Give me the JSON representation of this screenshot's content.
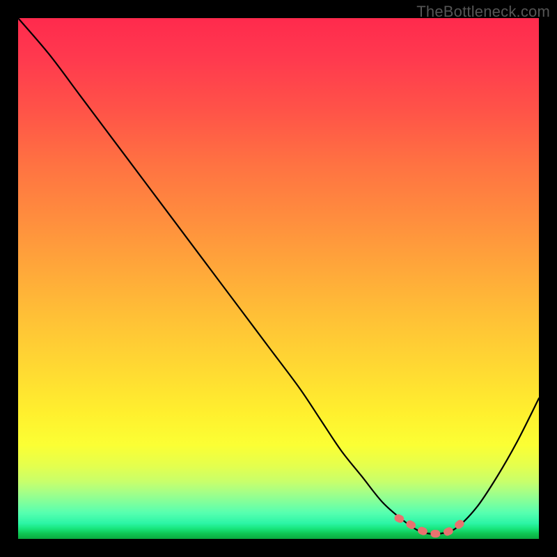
{
  "watermark": "TheBottleneck.com",
  "chart_data": {
    "type": "line",
    "title": "",
    "xlabel": "",
    "ylabel": "",
    "xlim": [
      0,
      100
    ],
    "ylim": [
      0,
      100
    ],
    "series": [
      {
        "name": "bottleneck-curve",
        "x": [
          0,
          6,
          12,
          18,
          24,
          30,
          36,
          42,
          48,
          54,
          58,
          62,
          66,
          70,
          74,
          77,
          79,
          81,
          84,
          88,
          92,
          96,
          100
        ],
        "values": [
          100,
          93,
          85,
          77,
          69,
          61,
          53,
          45,
          37,
          29,
          23,
          17,
          12,
          7,
          3.5,
          1.5,
          1,
          1,
          2,
          6,
          12,
          19,
          27
        ]
      }
    ],
    "highlight": {
      "name": "optimal-range",
      "x": [
        73,
        74,
        76,
        77,
        78,
        79,
        80,
        81,
        82,
        83,
        84,
        85,
        86
      ],
      "values": [
        4,
        3.5,
        2.4,
        1.8,
        1.4,
        1.1,
        1.0,
        1.0,
        1.2,
        1.6,
        2.2,
        3.0,
        3.6
      ],
      "color": "#e8726f"
    }
  }
}
